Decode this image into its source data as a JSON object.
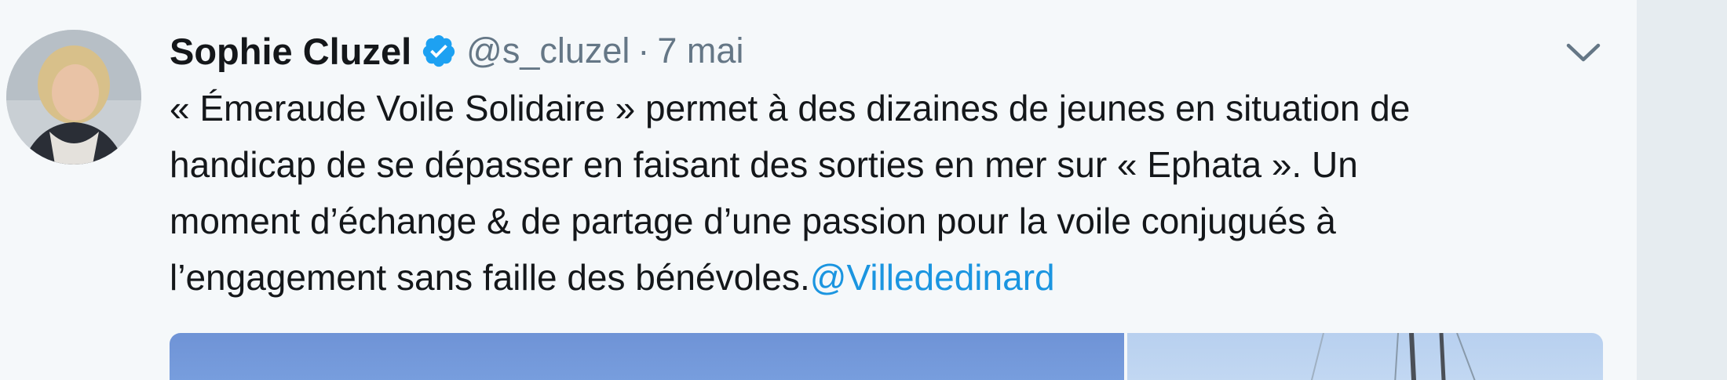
{
  "tweet": {
    "author_name": "Sophie Cluzel",
    "handle": "@s_cluzel",
    "separator": "·",
    "date": "7 mai",
    "body_lines": [
      "« Émeraude Voile Solidaire » permet à des dizaines de jeunes en situation de",
      "handicap de se dépasser en faisant des sorties en mer sur « Ephata ». Un",
      "moment d’échange & de partage d’une passion pour la voile conjugués à",
      "l’engagement sans faille des bénévoles."
    ],
    "mention": "@Villededinard"
  },
  "icons": {
    "verified": "verified-badge-icon",
    "menu": "chevron-down-icon"
  },
  "colors": {
    "text": "#14171a",
    "secondary": "#657786",
    "link": "#1b95e0",
    "verified": "#1da1f2",
    "background": "#f5f8fa",
    "gutter": "#e6ecf0"
  }
}
